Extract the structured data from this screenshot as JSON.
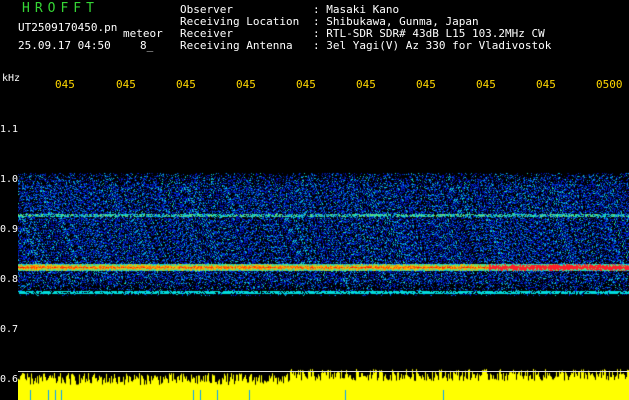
{
  "header": {
    "app_title": "HROFFT",
    "filename": "UT2509170450.pn",
    "meteor_label": "meteor",
    "datetime": "25.09.17 04:50",
    "count": "8_",
    "info": [
      {
        "key": "Observer",
        "value": ": Masaki Kano"
      },
      {
        "key": "Receiving Location",
        "value": ": Shibukawa, Gunma, Japan"
      },
      {
        "key": "Receiver",
        "value": ": RTL-SDR SDR# 43dB L15 103.2MHz CW"
      },
      {
        "key": "Receiving Antenna",
        "value": ": 3el Yagi(V) Az 330 for Vladivostok"
      }
    ]
  },
  "axis": {
    "unit": "kHz",
    "time_ticks": [
      "045",
      "045",
      "045",
      "045",
      "045",
      "045",
      "045",
      "045",
      "045",
      "0500"
    ],
    "freq_ticks": [
      "1.1",
      "1.0",
      "0.9",
      "0.8",
      "0.7",
      "0.6"
    ]
  },
  "colors": {
    "background": "#000000",
    "title": "#35d635",
    "ticks": "#ffd700",
    "text": "#ffffff",
    "signal_band": "#ff2020",
    "noise": "#1a3cff",
    "level_bars": "#ffff00"
  }
}
